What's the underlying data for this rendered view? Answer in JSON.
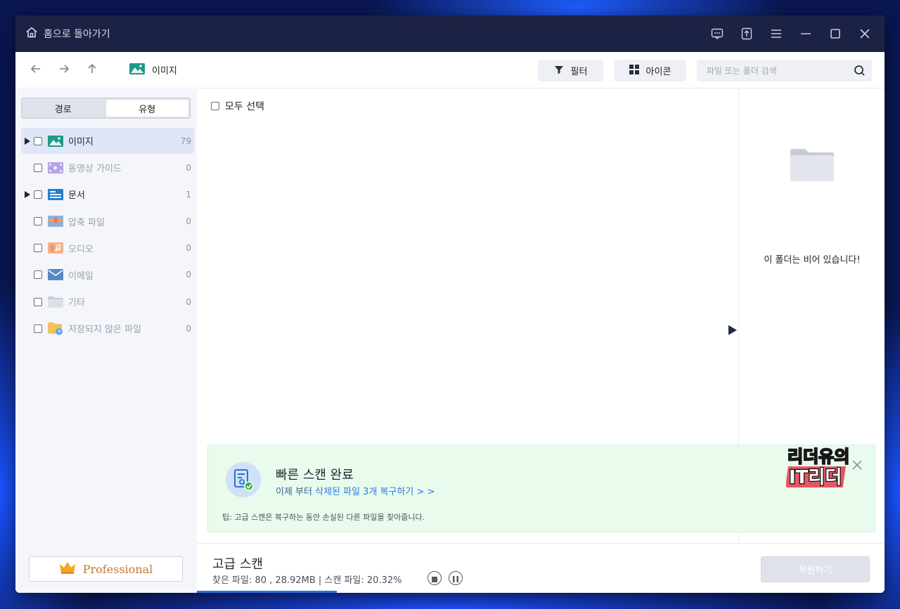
{
  "titlebar": {
    "home_label": "홈으로 돌아가기",
    "icons": [
      "feedback-icon",
      "upload-icon",
      "menu-icon",
      "minimize-icon",
      "maximize-icon",
      "close-icon"
    ]
  },
  "toolbar": {
    "breadcrumb": "이미지",
    "filter_label": "필터",
    "view_label": "아이콘",
    "search_placeholder": "파일 또는 폴더 검색"
  },
  "sidebar": {
    "tabs": [
      {
        "label": "경로",
        "active": false
      },
      {
        "label": "유형",
        "active": true
      }
    ],
    "items": [
      {
        "label": "이미지",
        "count": "79",
        "expandable": true,
        "dim": false,
        "selected": true,
        "icon": "image-folder-icon"
      },
      {
        "label": "동영상 가이드",
        "count": "0",
        "expandable": false,
        "dim": true,
        "selected": false,
        "icon": "video-folder-icon"
      },
      {
        "label": "문서",
        "count": "1",
        "expandable": true,
        "dim": false,
        "selected": false,
        "icon": "document-folder-icon"
      },
      {
        "label": "압축 파일",
        "count": "0",
        "expandable": false,
        "dim": true,
        "selected": false,
        "icon": "archive-folder-icon"
      },
      {
        "label": "오디오",
        "count": "0",
        "expandable": false,
        "dim": true,
        "selected": false,
        "icon": "audio-folder-icon"
      },
      {
        "label": "이메일",
        "count": "0",
        "expandable": false,
        "dim": true,
        "selected": false,
        "icon": "email-folder-icon"
      },
      {
        "label": "기타",
        "count": "0",
        "expandable": false,
        "dim": true,
        "selected": false,
        "icon": "other-folder-icon"
      },
      {
        "label": "저장되지 않은 파일",
        "count": "0",
        "expandable": false,
        "dim": true,
        "selected": false,
        "icon": "unsaved-folder-icon"
      }
    ],
    "pro_label": "Professional"
  },
  "main": {
    "select_all_label": "모두 선택"
  },
  "preview": {
    "empty_text": "이 폴더는 비어 있습니다!"
  },
  "banner": {
    "title": "빠른 스캔 완료",
    "sub_prefix": "이제 부터 ",
    "sub_link": "삭제된 파일 3개 복구하기 > >",
    "tip": "팁: 고급 스캔은 복구하는 동안 손실된 다른 파일을 찾아줍니다.",
    "watermark_text": "리더유의 IT리더"
  },
  "bottom": {
    "scan_title": "고급 스캔",
    "scan_stats": "찾은 파일: 80 , 28.92MB | 스캔 파일: 20.32%",
    "progress": 0.2032,
    "recover_label": "복원하기"
  },
  "colors": {
    "titlebar_bg": "#1c2244",
    "accent": "#2f6fe6",
    "banner_bg": "#e8fbec",
    "pro_text": "#c9762b"
  }
}
